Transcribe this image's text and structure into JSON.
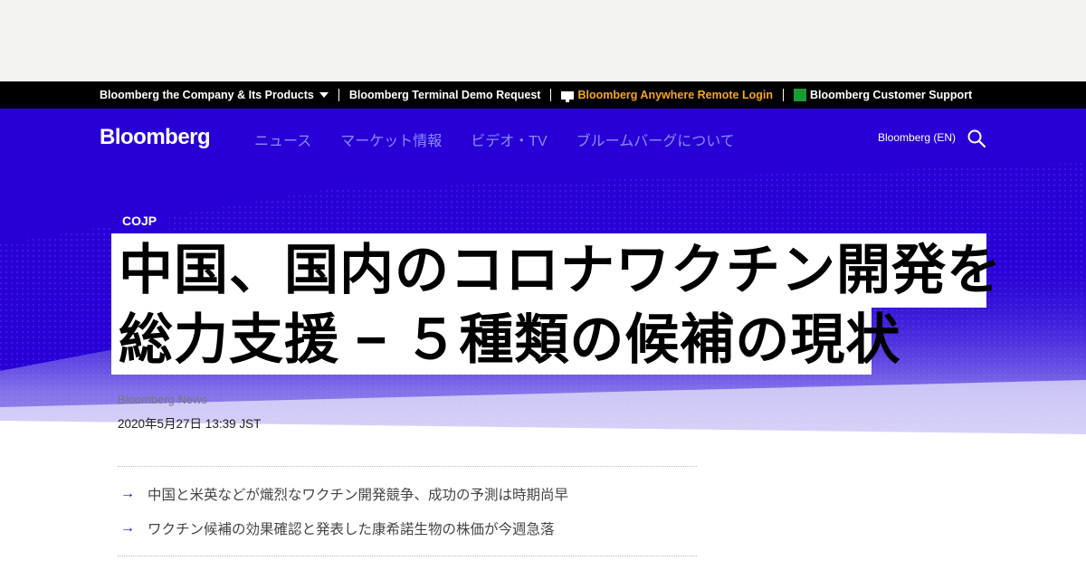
{
  "topbar": {
    "company": "Bloomberg the Company & Its Products",
    "terminal_demo": "Bloomberg Terminal Demo Request",
    "anywhere": "Bloomberg Anywhere Remote Login",
    "support": "Bloomberg Customer Support"
  },
  "nav": {
    "logo": "Bloomberg",
    "links": [
      "ニュース",
      "マーケット情報",
      "ビデオ・TV",
      "ブルームバーグについて"
    ],
    "edition": "Bloomberg (EN)"
  },
  "article": {
    "kicker": "COJP",
    "headline_line1": "中国、国内のコロナワクチン開発を",
    "headline_line2": "総力支援 − ５種類の候補の現状",
    "byline": "Bloomberg News",
    "date": "2020年5月27日 13:39 JST",
    "bullets": [
      "中国と米英などが熾烈なワクチン開発競争、成功の予測は時期尚早",
      "ワクチン候補の効果確認と発表した康希諾生物の株価が今週急落"
    ]
  },
  "colors": {
    "brand_blue": "#2800d7",
    "nav_link": "#8b8bff",
    "anywhere_orange": "#f5a623"
  },
  "icons": [
    "caret-down-icon",
    "terminal-icon",
    "help-icon",
    "search-icon",
    "arrow-right-icon"
  ]
}
